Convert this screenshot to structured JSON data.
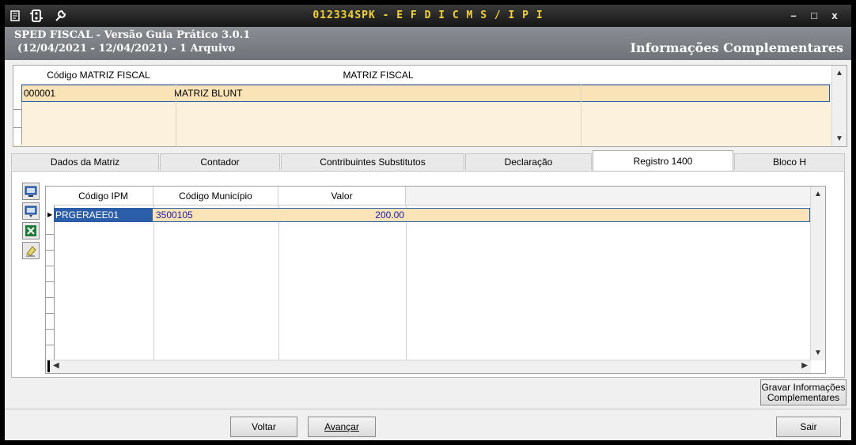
{
  "titlebar": {
    "title": "012334SPK - E F D  I C M S / I P I",
    "menu_icon": "list-icon",
    "tool_icon": "plugin-icon",
    "settings_icon": "wrench-icon",
    "minimize": "–",
    "maximize": "□",
    "close": "x"
  },
  "header": {
    "line1": "SPED FISCAL - Versão Guia Prático 3.0.1",
    "line2": "(12/04/2021 - 12/04/2021) - 1 Arquivo",
    "section": "Informações Complementares"
  },
  "top_grid": {
    "columns": [
      "Código MATRIZ FISCAL",
      "MATRIZ FISCAL"
    ],
    "rows": [
      {
        "codigo": "000001",
        "matriz": "MATRIZ BLUNT"
      }
    ]
  },
  "tabs": [
    {
      "label": "Dados da Matriz"
    },
    {
      "label": "Contador"
    },
    {
      "label": "Contribuintes Substitutos"
    },
    {
      "label": "Declaração"
    },
    {
      "label": "Registro 1400"
    },
    {
      "label": "Bloco H"
    }
  ],
  "active_tab": "Registro 1400",
  "side_tools": [
    "import-icon",
    "export-icon",
    "excel-icon",
    "eraser-icon"
  ],
  "registro_grid": {
    "columns": [
      "Código IPM",
      "Código Município",
      "Valor"
    ],
    "rows": [
      {
        "ipm": "PRGERAEE01",
        "municipio": "3500105",
        "valor": "200.00"
      }
    ]
  },
  "buttons": {
    "gravar_line1": "Gravar Informações",
    "gravar_line2": "Complementares",
    "voltar": "Voltar",
    "avancar": "Avançar",
    "sair": "Sair"
  },
  "colors": {
    "title_text": "#f2d23a",
    "header_bg": "#7b7f84",
    "selected_row": "#fbe3b8",
    "grid_bg": "#fbf1dc",
    "cell_text_blue": "#1a1aa6"
  }
}
